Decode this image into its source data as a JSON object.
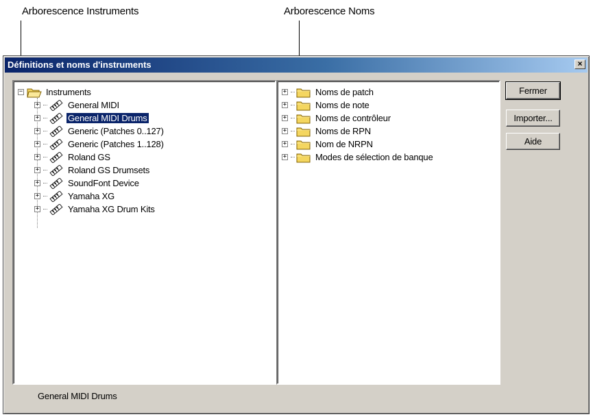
{
  "callouts": {
    "instruments_tree": "Arborescence Instruments",
    "names_tree": "Arborescence Noms"
  },
  "dialog": {
    "title": "Définitions et noms d'instruments",
    "close_glyph": "×"
  },
  "instruments_tree": {
    "root_label": "Instruments",
    "items": [
      {
        "label": "General MIDI",
        "selected": false
      },
      {
        "label": "General MIDI Drums",
        "selected": true
      },
      {
        "label": "Generic (Patches 0..127)",
        "selected": false
      },
      {
        "label": "Generic (Patches 1..128)",
        "selected": false
      },
      {
        "label": "Roland GS",
        "selected": false
      },
      {
        "label": "Roland GS Drumsets",
        "selected": false
      },
      {
        "label": "SoundFont Device",
        "selected": false
      },
      {
        "label": "Yamaha XG",
        "selected": false
      },
      {
        "label": "Yamaha XG Drum Kits",
        "selected": false
      }
    ]
  },
  "names_tree": {
    "items": [
      {
        "label": "Noms de patch"
      },
      {
        "label": "Noms de note"
      },
      {
        "label": "Noms de contrôleur"
      },
      {
        "label": "Noms de RPN"
      },
      {
        "label": "Nom de NRPN"
      },
      {
        "label": "Modes de sélection de banque"
      }
    ]
  },
  "buttons": {
    "close": "Fermer",
    "import": "Importer...",
    "help": "Aide"
  },
  "status": {
    "selected_instrument": "General MIDI Drums"
  },
  "tree_glyphs": {
    "expand": "+",
    "collapse": "−"
  },
  "icons": {
    "folder": "folder-icon",
    "open_folder": "folder-open-icon",
    "instrument": "instrument-icon"
  },
  "colors": {
    "title_bar_start": "#0a246a",
    "title_bar_end": "#a6caf0",
    "selection": "#0a246a",
    "window_face": "#d4d0c8",
    "folder_yellow": "#f4d660"
  }
}
